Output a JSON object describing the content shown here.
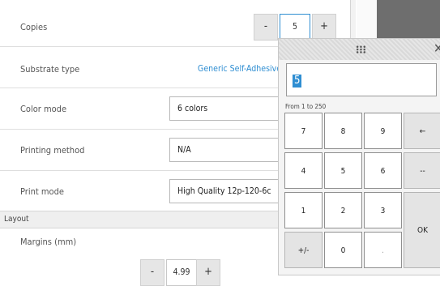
{
  "settings": {
    "copies": {
      "label": "Copies",
      "value": "5",
      "minus": "-",
      "plus": "+"
    },
    "substrate": {
      "label": "Substrate type",
      "value": "Generic Self-Adhesive"
    },
    "color_mode": {
      "label": "Color mode",
      "value": "6 colors"
    },
    "printing_method": {
      "label": "Printing method",
      "value": "N/A"
    },
    "print_mode": {
      "label": "Print mode",
      "value": "High Quality 12p-120-6c"
    },
    "layout_section": "Layout",
    "margins": {
      "label": "Margins (mm)",
      "value": "4.99",
      "minus": "-",
      "plus": "+"
    }
  },
  "colors": {
    "accent": "#2f8ed2"
  },
  "keypad": {
    "close_icon": "close-icon",
    "grip_icon": "drag-grip-icon",
    "display_value": "5",
    "range_text": "From 1 to 250",
    "keys": {
      "k7": "7",
      "k8": "8",
      "k9": "9",
      "backspace": "←",
      "k4": "4",
      "k5": "5",
      "k6": "6",
      "dash": "--",
      "k1": "1",
      "k2": "2",
      "k3": "3",
      "ok": "OK",
      "sign": "+/-",
      "k0": "0",
      "dot": "."
    }
  }
}
